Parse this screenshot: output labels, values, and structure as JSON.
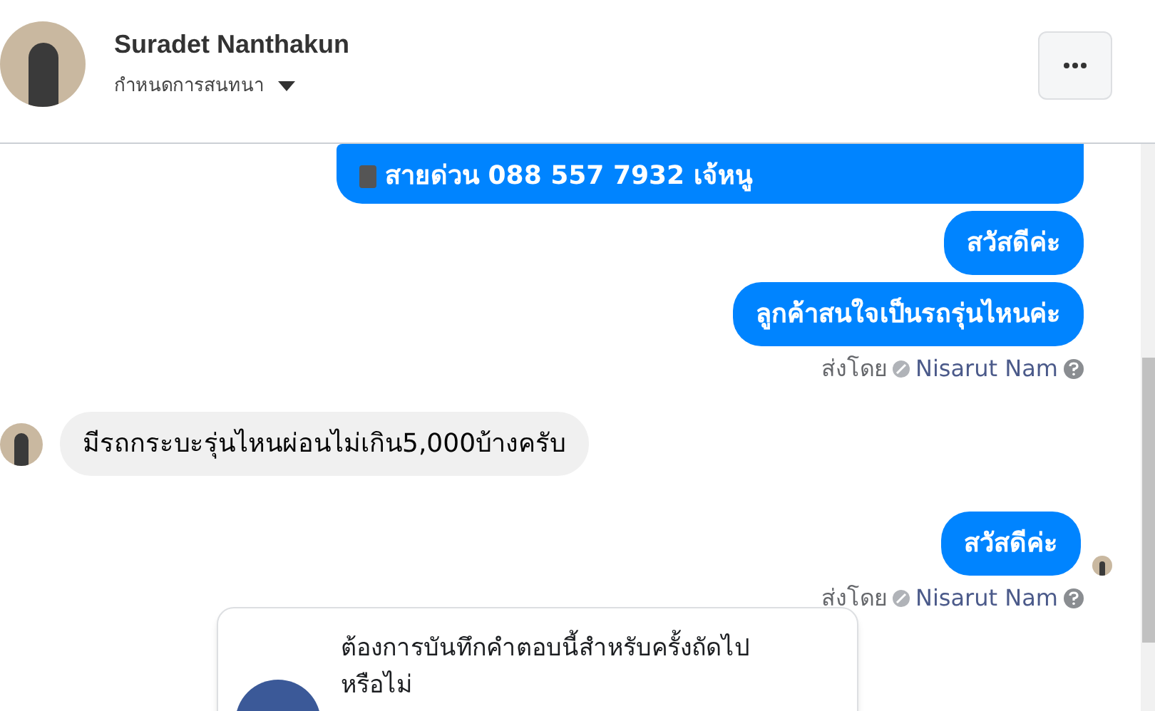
{
  "header": {
    "name": "Suradet Nanthakun",
    "subtitle": "กำหนดการสนทนา"
  },
  "messages": [
    {
      "kind": "outgoing",
      "text": "สายด่วน 088 557 7932 เจ้หนู",
      "icon": true,
      "seen": false
    },
    {
      "kind": "outgoing",
      "text": "สวัสดีค่ะ",
      "icon": false,
      "seen": false
    },
    {
      "kind": "outgoing",
      "text": "ลูกค้าสนใจเป็นรถรุ่นไหนค่ะ",
      "icon": false,
      "seen": false
    },
    {
      "kind": "sender",
      "label": "ส่งโดย",
      "name": "Nisarut Nam"
    },
    {
      "kind": "incoming",
      "text": "มีรถกระบะรุ่นไหนผ่อนไม่เกิน5,000บ้างครับ"
    },
    {
      "kind": "outgoing",
      "text": "สวัสดีค่ะ",
      "icon": false,
      "seen": true
    },
    {
      "kind": "sender",
      "label": "ส่งโดย",
      "name": "Nisarut Nam"
    }
  ],
  "prompt_card": {
    "title": "ต้องการบันทึกคำตอบนี้สำหรับครั้งถัดไปหรือไม่"
  }
}
